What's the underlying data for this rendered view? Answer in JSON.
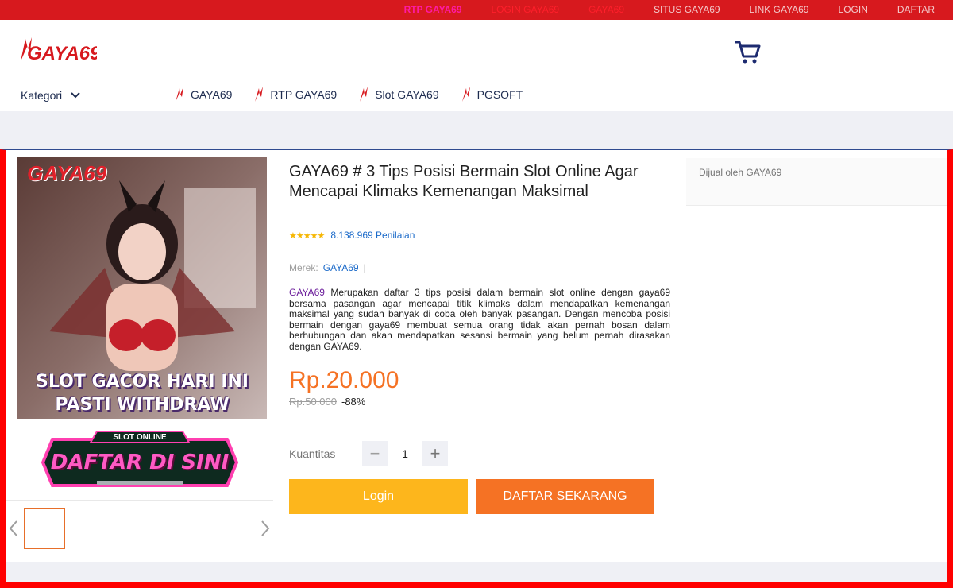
{
  "topbar": {
    "links": [
      "RTP GAYA69",
      "LOGIN GAYA69",
      "GAYA69",
      "SITUS GAYA69",
      "LINK GAYA69",
      "LOGIN",
      "DAFTAR"
    ],
    "bg_color": "#d7191e"
  },
  "header": {
    "logo_text": "GAYA69",
    "cart_icon": "cart-icon",
    "kategori_label": "Kategori",
    "nav": [
      "GAYA69",
      "RTP GAYA69",
      "Slot GAYA69",
      "PGSOFT"
    ]
  },
  "gallery": {
    "banner_logo": "GAYA69",
    "banner_line1": "SLOT GACOR HARI INI",
    "banner_line2": "PASTI WITHDRAW",
    "cta_top": "SLOT ONLINE",
    "cta_main": "DAFTAR DI SINI"
  },
  "product": {
    "title": "GAYA69 # 3 Tips Posisi Bermain Slot Online Agar Mencapai Klimaks Kemenangan Maksimal",
    "stars": "★★★★★",
    "ratings": "8.138.969 Penilaian",
    "brand_label": "Merek:",
    "brand_value": "GAYA69",
    "brand_sep": "|",
    "desc_keyword": "GAYA69",
    "desc_text": " Merupakan daftar 3 tips posisi dalam bermain slot online dengan gaya69 bersama pasangan agar mencapai titik klimaks dalam mendapatkan kemenangan maksimal yang sudah banyak di coba oleh banyak pasangan. Dengan mencoba posisi bermain dengan gaya69 membuat semua orang tidak akan pernah bosan dalam berhubungan dan akan mendapatkan sesansi bermain yang belum pernah dirasakan dengan GAYA69.",
    "price": "Rp.20.000",
    "old_price": "Rp.50.000",
    "discount": "-88%",
    "qty_label": "Kuantitas",
    "qty_minus": "−",
    "qty_value": "1",
    "qty_plus": "+",
    "login_btn": "Login",
    "daftar_btn": "DAFTAR SEKARANG"
  },
  "seller": {
    "text": "Dijual oleh GAYA69"
  },
  "colors": {
    "accent": "#f57224",
    "login": "#fdb61c",
    "frame": "#ff0000"
  }
}
